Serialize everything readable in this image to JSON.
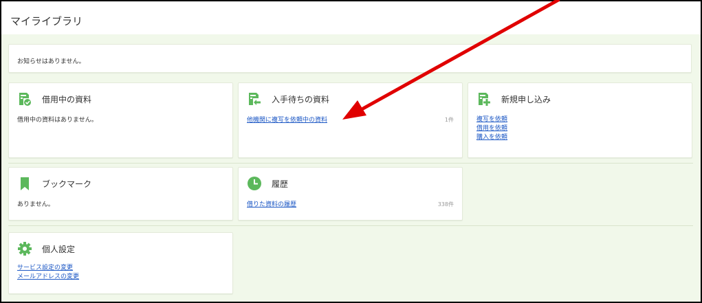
{
  "header": {
    "title": "マイライブラリ"
  },
  "notice": {
    "text": "お知らせはありません。"
  },
  "cards": {
    "borrowing": {
      "title": "借用中の資料",
      "empty_text": "借用中の資料はありません。"
    },
    "waiting": {
      "title": "入手待ちの資料",
      "link_label": "他機関に複写を依頼中の資料",
      "count": "1件"
    },
    "new_request": {
      "title": "新規申し込み",
      "links": [
        "複写を依頼",
        "借用を依頼",
        "購入を依頼"
      ]
    },
    "bookmark": {
      "title": "ブックマーク",
      "empty_text": "ありません。"
    },
    "history": {
      "title": "履歴",
      "link_label": "借りた資料の履歴",
      "count": "338件"
    },
    "settings": {
      "title": "個人設定",
      "links": [
        "サービス設定の変更",
        "メールアドレスの変更"
      ]
    }
  },
  "colors": {
    "accent_green": "#5cb85c",
    "link_blue": "#1a56c4",
    "annotation_red": "#e00000",
    "background": "#f1f8ea"
  },
  "icons": {
    "borrowing": "book-check-icon",
    "waiting": "book-arrow-icon",
    "new_request": "book-plus-icon",
    "bookmark": "bookmark-icon",
    "history": "clock-icon",
    "settings": "gear-icon"
  }
}
